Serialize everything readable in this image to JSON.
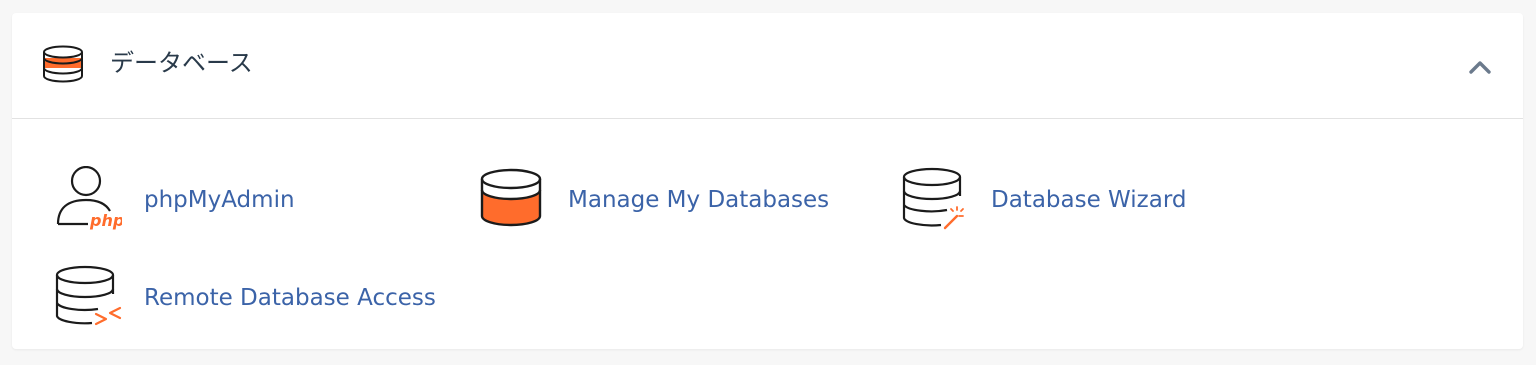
{
  "section": {
    "title": "データベース",
    "icon": "database-icon",
    "collapse_icon": "chevron-up-icon"
  },
  "items": [
    {
      "label": "phpMyAdmin",
      "icon": "phpmyadmin-user-icon"
    },
    {
      "label": "Manage My Databases",
      "icon": "database-icon"
    },
    {
      "label": "Database Wizard",
      "icon": "database-wizard-icon"
    },
    {
      "label": "Remote Database Access",
      "icon": "remote-database-icon"
    }
  ],
  "colors": {
    "accent": "#ff6c2c",
    "link": "#3b63a8",
    "title": "#293a4a",
    "icon_stroke": "#1b1b1b"
  }
}
